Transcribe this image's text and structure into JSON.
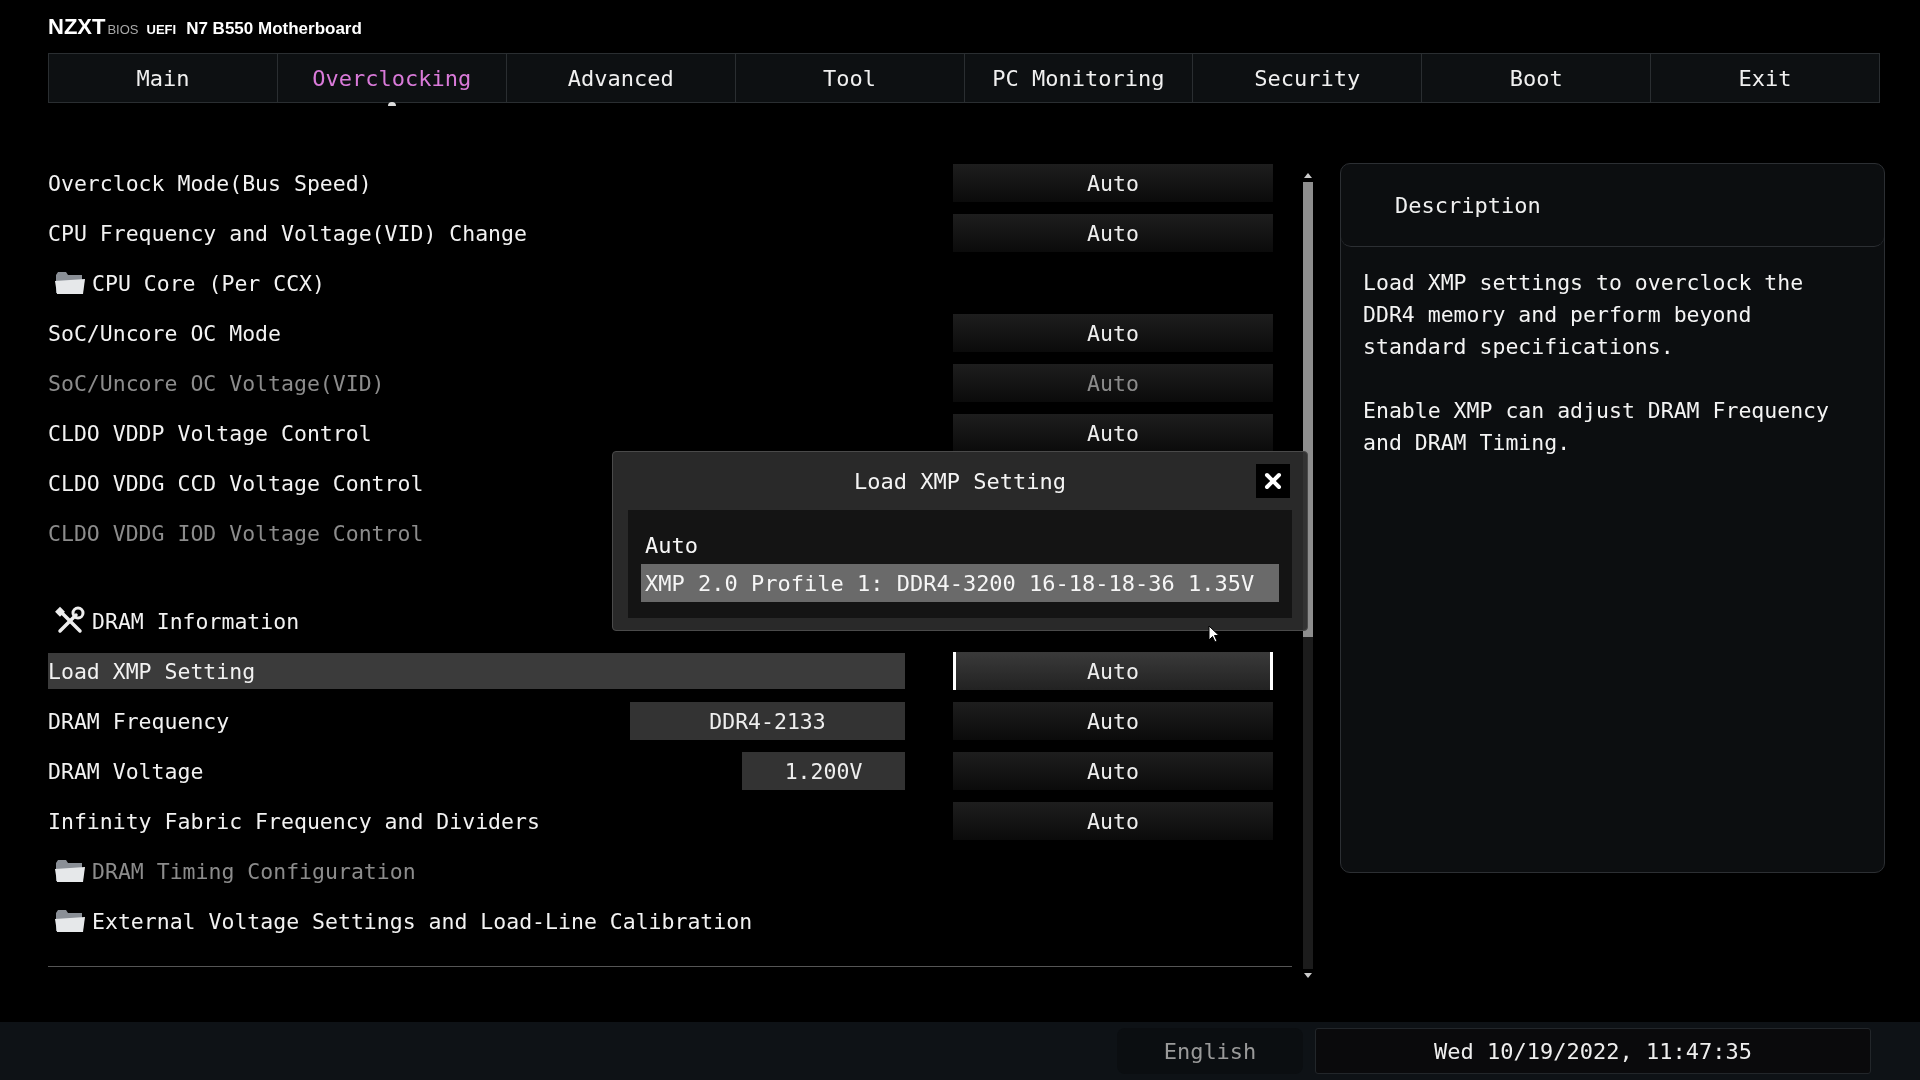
{
  "header": {
    "brand": "NZXT",
    "bios_label": "BIOS",
    "uefi_label": "UEFI",
    "model": "N7 B550 Motherboard"
  },
  "tabs": [
    {
      "label": "Main",
      "selected": false
    },
    {
      "label": "Overclocking",
      "selected": true
    },
    {
      "label": "Advanced",
      "selected": false
    },
    {
      "label": "Tool",
      "selected": false
    },
    {
      "label": "PC Monitoring",
      "selected": false
    },
    {
      "label": "Security",
      "selected": false
    },
    {
      "label": "Boot",
      "selected": false
    },
    {
      "label": "Exit",
      "selected": false
    }
  ],
  "settings": [
    {
      "kind": "option",
      "label": "Overclock Mode(Bus Speed)",
      "disabled": false,
      "selected": false,
      "value": "Auto"
    },
    {
      "kind": "option",
      "label": "CPU Frequency and Voltage(VID) Change",
      "disabled": false,
      "selected": false,
      "value": "Auto"
    },
    {
      "kind": "folder",
      "label": "CPU Core (Per CCX)",
      "disabled": false
    },
    {
      "kind": "option",
      "label": "SoC/Uncore OC Mode",
      "disabled": false,
      "selected": false,
      "value": "Auto"
    },
    {
      "kind": "option",
      "label": "SoC/Uncore OC Voltage(VID)",
      "disabled": true,
      "selected": false,
      "value": "Auto"
    },
    {
      "kind": "option",
      "label": "CLDO VDDP Voltage Control",
      "disabled": false,
      "selected": false,
      "value": "Auto"
    },
    {
      "kind": "option",
      "label": "CLDO VDDG CCD Voltage Control",
      "disabled": false,
      "selected": false
    },
    {
      "kind": "option",
      "label": "CLDO VDDG IOD Voltage Control",
      "disabled": true,
      "selected": false
    },
    {
      "kind": "section",
      "label": "DRAM Information"
    },
    {
      "kind": "option",
      "label": "Load XMP Setting",
      "disabled": false,
      "selected": true,
      "value": "Auto"
    },
    {
      "kind": "option",
      "label": "DRAM Frequency",
      "disabled": false,
      "selected": false,
      "info": "DDR4-2133",
      "value": "Auto"
    },
    {
      "kind": "option",
      "label": "DRAM Voltage",
      "disabled": false,
      "selected": false,
      "info": "1.200V",
      "value": "Auto"
    },
    {
      "kind": "option",
      "label": "Infinity Fabric Frequency and Dividers",
      "disabled": false,
      "selected": false,
      "value": "Auto"
    },
    {
      "kind": "folder",
      "label": "DRAM Timing Configuration",
      "disabled": true
    },
    {
      "kind": "folder",
      "label": "External Voltage Settings and Load-Line Calibration",
      "disabled": false
    }
  ],
  "popup": {
    "title": "Load XMP Setting",
    "options": [
      {
        "label": "Auto",
        "selected": false
      },
      {
        "label": "XMP 2.0 Profile 1: DDR4-3200 16-18-18-36 1.35V",
        "selected": true
      }
    ]
  },
  "description": {
    "title": "Description",
    "paragraphs": [
      "Load XMP settings to overclock the DDR4 memory and perform beyond standard specifications.",
      "Enable XMP can adjust DRAM Frequency and DRAM Timing."
    ]
  },
  "status_bar": {
    "language": "English",
    "datetime": "Wed 10/19/2022, 11:47:35"
  }
}
